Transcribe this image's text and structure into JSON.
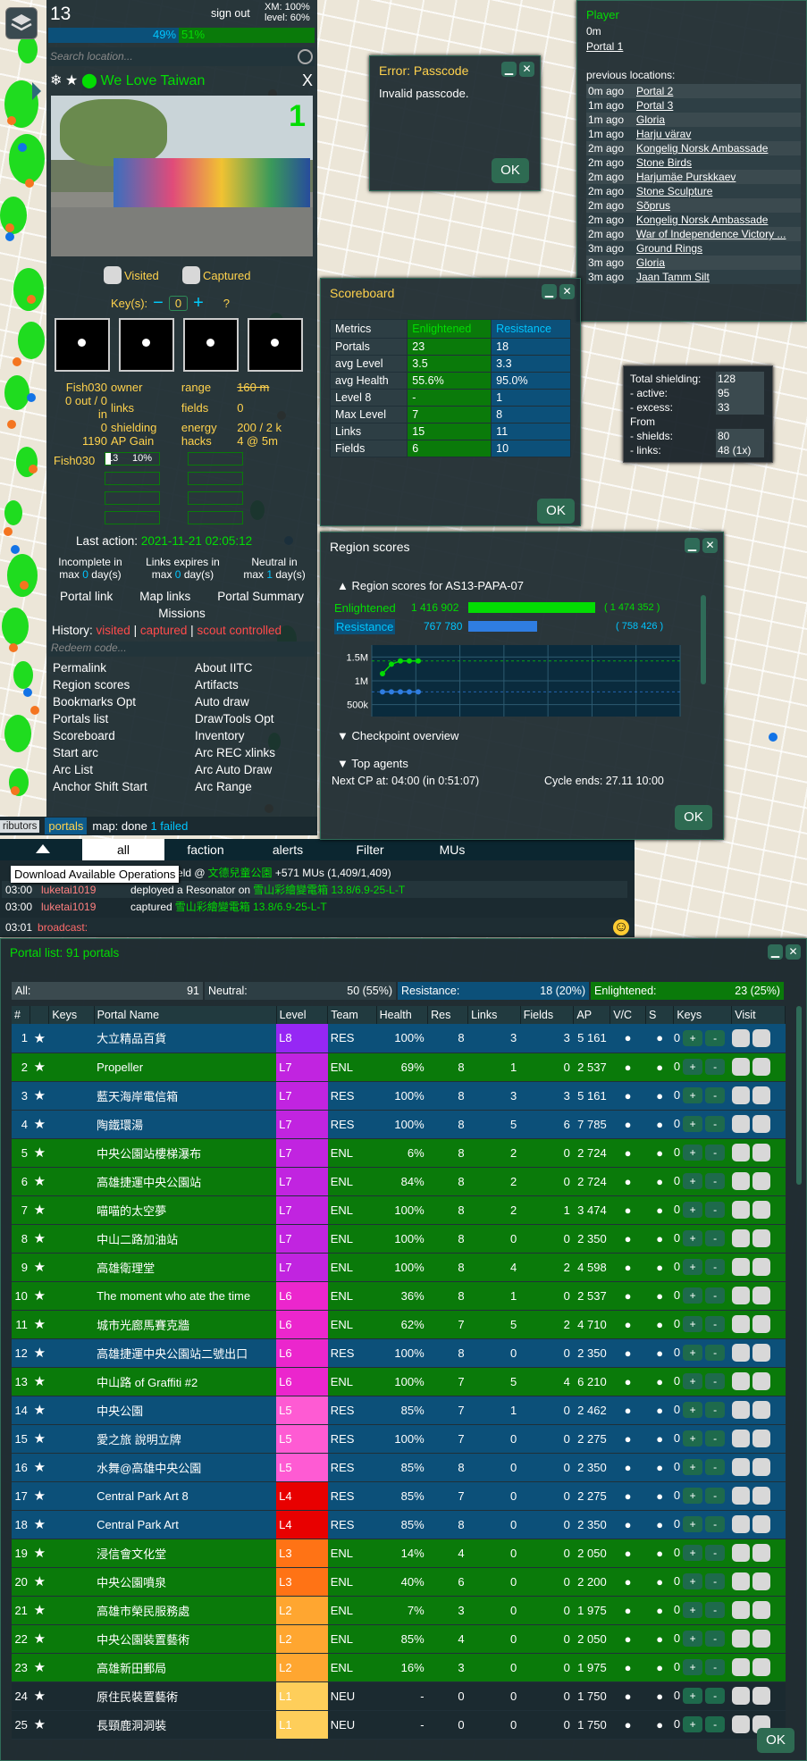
{
  "colors": {
    "enl": "#0a7a0a",
    "res": "#0c5079",
    "gold": "#ffd24d",
    "accent": "#03dc03",
    "blue": "#00c5ff"
  },
  "topbar": {
    "level": "13",
    "signout": "sign out",
    "xm": "XM: 100%",
    "lvl": "level: 60%",
    "bar_res": "49%",
    "bar_enl": "51%",
    "bar_res_fraction": 0.49,
    "search_placeholder": "Search location..."
  },
  "portal": {
    "name": "We Love Taiwan",
    "close": "X",
    "level": "1",
    "visited": "Visited",
    "captured": "Captured",
    "keys_label": "Key(s):",
    "keys_value": "0",
    "keys_minus": "−",
    "keys_plus": "+",
    "keys_help": "?",
    "stats": [
      [
        "Fish030",
        "owner",
        "range",
        "160 m"
      ],
      [
        "0 out / 0 in",
        "links",
        "fields",
        "0"
      ],
      [
        "0",
        "shielding",
        "energy",
        "200 / 2 k"
      ],
      [
        "1190",
        "AP Gain",
        "hacks",
        "4 @ 5m"
      ]
    ],
    "reso_owner": "Fish030",
    "reso_level": "L3",
    "reso_pct": "10%",
    "reso_pct_fraction": 0.1,
    "last_action_label": "Last action:",
    "last_action": "2021-11-21 02:05:12",
    "decay": [
      [
        "Incomplete in",
        "max ",
        "0",
        " day(s)"
      ],
      [
        "Links expires in",
        "max ",
        "0",
        " day(s)"
      ],
      [
        "Neutral in",
        "max ",
        "1",
        " day(s)"
      ]
    ],
    "links": [
      "Portal link",
      "Map links",
      "Portal Summary"
    ],
    "missions": "Missions",
    "history_label": "History:",
    "hist_visited": "visited",
    "hist_captured": "captured",
    "hist_scout": "scout controlled",
    "sep": "|",
    "redeem": "Redeem code...",
    "menu_left": [
      "Permalink",
      "Region scores",
      "Bookmarks Opt",
      "Portals list",
      "Scoreboard",
      "Start arc",
      "Arc List",
      "Anchor Shift Start"
    ],
    "menu_right": [
      "About IITC",
      "Artifacts",
      "Auto draw",
      "DrawTools Opt",
      "Inventory",
      "Arc REC xlinks",
      "Arc Auto Draw",
      "Arc Range"
    ]
  },
  "statusbar": {
    "contributors": "ributors",
    "portals": "portals",
    "map_done": "map: done",
    "failed": "1 failed"
  },
  "chat": {
    "tabs": [
      "all",
      "faction",
      "alerts",
      "Filter",
      "MUs"
    ],
    "tooltip": "Download Available Operations",
    "lines": [
      [
        "",
        "",
        "Control Field @",
        "文德兒童公園",
        " +571 MUs (1,409/1,409)"
      ],
      [
        "03:00",
        "luketai1019",
        "deployed a Resonator on",
        "雪山彩繪變電箱 13.8/6.9-25-L-T",
        ""
      ],
      [
        "03:00",
        "luketai1019",
        "captured",
        "雪山彩繪變電箱 13.8/6.9-25-L-T",
        ""
      ]
    ],
    "input_time": "03:01",
    "input_label": "broadcast:",
    "smile": "☺"
  },
  "error": {
    "title": "Error: Passcode",
    "text": "Invalid passcode.",
    "ok": "OK"
  },
  "player": {
    "title": "Player",
    "distance": "0m",
    "portal": "Portal 1",
    "prev_label": "previous locations:",
    "rows": [
      [
        "0m ago",
        "Portal 2"
      ],
      [
        "1m ago",
        "Portal 3"
      ],
      [
        "1m ago",
        "Gloria"
      ],
      [
        "1m ago",
        "Harju värav"
      ],
      [
        "2m ago",
        "Kongelig Norsk Ambassade"
      ],
      [
        "2m ago",
        "Stone Birds"
      ],
      [
        "2m ago",
        "Harjumäe Purskkaev"
      ],
      [
        "2m ago",
        "Stone Sculpture"
      ],
      [
        "2m ago",
        "Sõprus"
      ],
      [
        "2m ago",
        "Kongelig Norsk Ambassade"
      ],
      [
        "2m ago",
        "War of Independence Victory ..."
      ],
      [
        "3m ago",
        "Ground Rings"
      ],
      [
        "3m ago",
        "Gloria"
      ],
      [
        "3m ago",
        "Jaan Tamm Silt"
      ]
    ]
  },
  "shielding": {
    "rows": [
      [
        "Total shielding:",
        "128"
      ],
      [
        "- active:",
        "95"
      ],
      [
        "- excess:",
        "33"
      ],
      [
        "From",
        ""
      ],
      [
        "- shields:",
        "80"
      ],
      [
        "- links:",
        "48 (1x)"
      ]
    ]
  },
  "scoreboard": {
    "title": "Scoreboard",
    "headers": [
      "Metrics",
      "Enlightened",
      "Resistance"
    ],
    "rows": [
      [
        "Portals",
        "23",
        "18"
      ],
      [
        "avg Level",
        "3.5",
        "3.3"
      ],
      [
        "avg Health",
        "55.6%",
        "95.0%"
      ],
      [
        "Level 8",
        "-",
        "1"
      ],
      [
        "Max Level",
        "7",
        "8"
      ],
      [
        "Links",
        "15",
        "11"
      ],
      [
        "Fields",
        "6",
        "10"
      ]
    ],
    "ok": "OK"
  },
  "region": {
    "title": "Region scores",
    "subtitle": "▲ Region scores for AS13-PAPA-07",
    "enl_label": "Enlightened",
    "res_label": "Resistance",
    "enl_score": "1 416 902",
    "enl_total": "( 1 474 352 )",
    "res_score": "767 780",
    "res_total": "( 758 426 )",
    "enl_fraction": 0.96,
    "res_fraction": 0.52,
    "y_ticks": [
      "1.5M",
      "1M",
      "500k"
    ],
    "checkpoint": "▼ Checkpoint overview",
    "top_agents": "▼ Top agents",
    "next_cp": "Next CP at: 04:00 (in 0:51:07)",
    "cycle_end": "Cycle ends: 27.11 10:00",
    "ok": "OK"
  },
  "chart_data": {
    "type": "line",
    "title": "",
    "y_ticks": [
      "1.5M",
      "1M",
      "500k"
    ],
    "ylim": [
      250000,
      1750000
    ],
    "series": [
      {
        "name": "Enlightened",
        "color": "#03dc03",
        "values": [
          1150000,
          1350000,
          1416902,
          1416902,
          1416902
        ]
      },
      {
        "name": "Resistance",
        "color": "#2f7de1",
        "values": [
          767780,
          767780,
          767780,
          767780,
          767780
        ]
      }
    ]
  },
  "portallist": {
    "title": "Portal list: 91 portals",
    "ok": "OK",
    "summary": [
      [
        "All:",
        "91"
      ],
      [
        "Neutral:",
        "50 (55%)"
      ],
      [
        "Resistance:",
        "18 (20%)"
      ],
      [
        "Enlightened:",
        "23 (25%)"
      ]
    ],
    "headers": [
      "#",
      "",
      "Keys",
      "Portal Name",
      "Level",
      "Team",
      "Health",
      "Res",
      "Links",
      "Fields",
      "AP",
      "V/C",
      "S",
      "Keys",
      "Visit"
    ],
    "rows": [
      [
        "1",
        "大立精品百貨",
        "L8",
        "RES",
        "100%",
        "8",
        "3",
        "3",
        "5 161",
        "0"
      ],
      [
        "2",
        "Propeller",
        "L7",
        "ENL",
        "69%",
        "8",
        "1",
        "0",
        "2 537",
        "0"
      ],
      [
        "3",
        "藍天海岸電信箱",
        "L7",
        "RES",
        "100%",
        "8",
        "3",
        "3",
        "5 161",
        "0"
      ],
      [
        "4",
        "陶鐵環湯",
        "L7",
        "RES",
        "100%",
        "8",
        "5",
        "6",
        "7 785",
        "0"
      ],
      [
        "5",
        "中央公園站樓梯瀑布",
        "L7",
        "ENL",
        "6%",
        "8",
        "2",
        "0",
        "2 724",
        "0"
      ],
      [
        "6",
        "高雄捷運中央公園站",
        "L7",
        "ENL",
        "84%",
        "8",
        "2",
        "0",
        "2 724",
        "0"
      ],
      [
        "7",
        "喵喵的太空夢",
        "L7",
        "ENL",
        "100%",
        "8",
        "2",
        "1",
        "3 474",
        "0"
      ],
      [
        "8",
        "中山二路加油站",
        "L7",
        "ENL",
        "100%",
        "8",
        "0",
        "0",
        "2 350",
        "0"
      ],
      [
        "9",
        "高雄衛理堂",
        "L7",
        "ENL",
        "100%",
        "8",
        "4",
        "2",
        "4 598",
        "0"
      ],
      [
        "10",
        "The moment who ate the time",
        "L6",
        "ENL",
        "36%",
        "8",
        "1",
        "0",
        "2 537",
        "0"
      ],
      [
        "11",
        "城市光廊馬賽克牆",
        "L6",
        "ENL",
        "62%",
        "7",
        "5",
        "2",
        "4 710",
        "0"
      ],
      [
        "12",
        "高雄捷運中央公園站二號出口",
        "L6",
        "RES",
        "100%",
        "8",
        "0",
        "0",
        "2 350",
        "0"
      ],
      [
        "13",
        "中山路 of Graffiti #2",
        "L6",
        "ENL",
        "100%",
        "7",
        "5",
        "4",
        "6 210",
        "0"
      ],
      [
        "14",
        "中央公園",
        "L5",
        "RES",
        "85%",
        "7",
        "1",
        "0",
        "2 462",
        "0"
      ],
      [
        "15",
        "愛之旅 說明立牌",
        "L5",
        "RES",
        "100%",
        "7",
        "0",
        "0",
        "2 275",
        "0"
      ],
      [
        "16",
        "水舞@高雄中央公園",
        "L5",
        "RES",
        "85%",
        "8",
        "0",
        "0",
        "2 350",
        "0"
      ],
      [
        "17",
        "Central Park Art 8",
        "L4",
        "RES",
        "85%",
        "7",
        "0",
        "0",
        "2 275",
        "0"
      ],
      [
        "18",
        "Central Park Art",
        "L4",
        "RES",
        "85%",
        "8",
        "0",
        "0",
        "2 350",
        "0"
      ],
      [
        "19",
        "浸信會文化堂",
        "L3",
        "ENL",
        "14%",
        "4",
        "0",
        "0",
        "2 050",
        "0"
      ],
      [
        "20",
        "中央公園噴泉",
        "L3",
        "ENL",
        "40%",
        "6",
        "0",
        "0",
        "2 200",
        "0"
      ],
      [
        "21",
        "高雄市榮民服務處",
        "L2",
        "ENL",
        "7%",
        "3",
        "0",
        "0",
        "1 975",
        "0"
      ],
      [
        "22",
        "中央公園裝置藝術",
        "L2",
        "ENL",
        "85%",
        "4",
        "0",
        "0",
        "2 050",
        "0"
      ],
      [
        "23",
        "高雄新田郵局",
        "L2",
        "ENL",
        "16%",
        "3",
        "0",
        "0",
        "1 975",
        "0"
      ],
      [
        "24",
        "原住民裝置藝術",
        "L1",
        "NEU",
        "-",
        "0",
        "0",
        "0",
        "1 750",
        "0"
      ],
      [
        "25",
        "長頸鹿洞洞裝",
        "L1",
        "NEU",
        "-",
        "0",
        "0",
        "0",
        "1 750",
        "0"
      ]
    ],
    "level_colors": {
      "L8": "#9627f4",
      "L7": "#c124e0",
      "L6": "#eb26cd",
      "L5": "#fe5bd3",
      "L4": "#e80000",
      "L3": "#ff7315",
      "L2": "#ffa630",
      "L1": "#fece5a"
    },
    "dot": "●",
    "plus": "+",
    "minus": "-",
    "star": "★"
  }
}
